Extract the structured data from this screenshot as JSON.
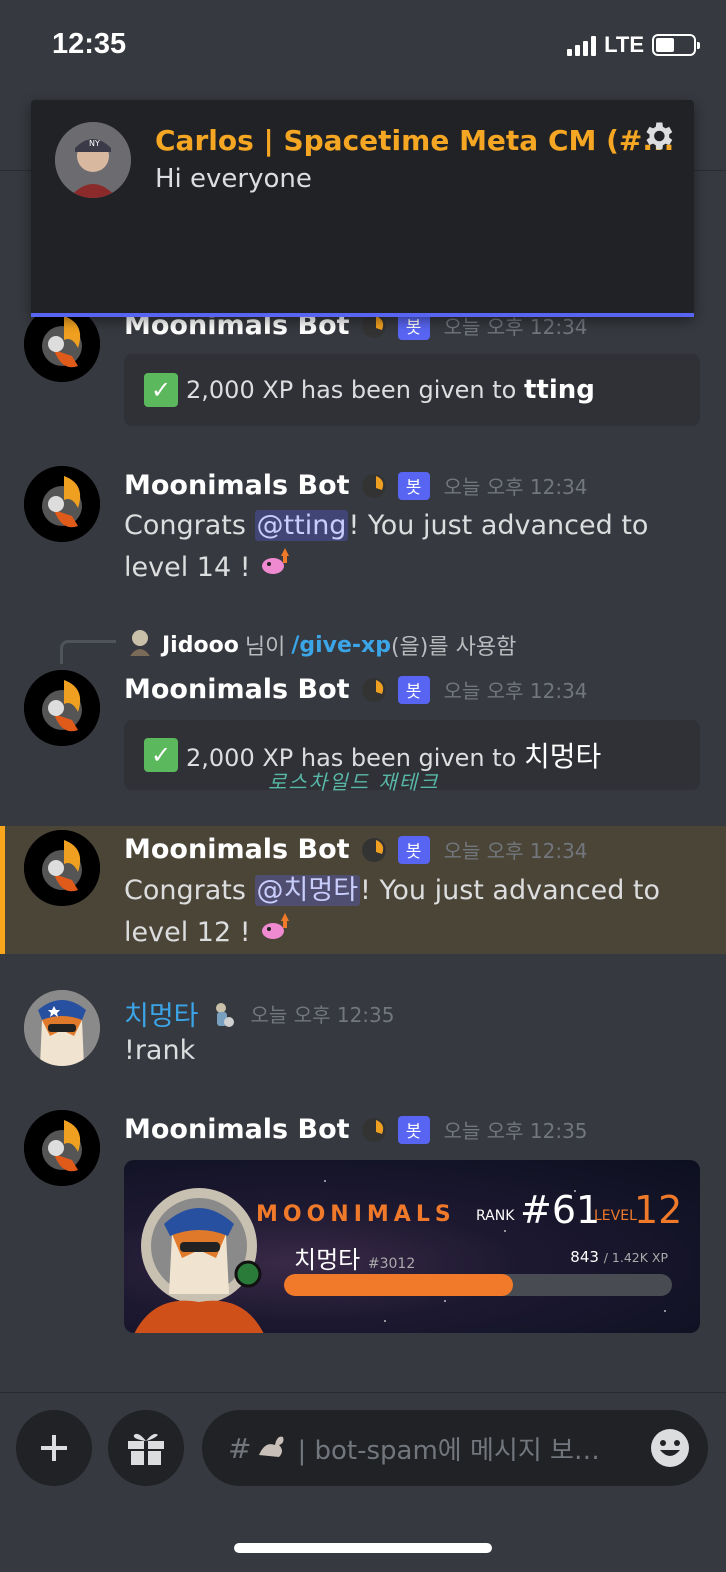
{
  "status_bar": {
    "time": "12:35",
    "network": "LTE"
  },
  "notification": {
    "author": "Carlos | Spacetime Meta CM (#...",
    "text": "Hi everyone"
  },
  "messages": [
    {
      "author": "Moonimals Bot",
      "badge": "봇",
      "timestamp": "오늘 오후 12:34",
      "embed_text": "2,000 XP has been given to ",
      "embed_bold": "tting"
    },
    {
      "author": "Moonimals Bot",
      "badge": "봇",
      "timestamp": "오늘 오후 12:34",
      "text_pre": "Congrats ",
      "mention": "@tting",
      "text_post": "! You just advanced to level 14 !"
    },
    {
      "author": "Moonimals Bot",
      "badge": "봇",
      "timestamp": "오늘 오후 12:34",
      "reply_user": "Jidooo",
      "reply_mid": "님이",
      "reply_cmd": "/give-xp",
      "reply_end": "(을)를 사용함",
      "embed_text": "2,000 XP has been given to ",
      "embed_bold": "치멍타"
    },
    {
      "author": "Moonimals Bot",
      "badge": "봇",
      "timestamp": "오늘 오후 12:34",
      "text_pre": "Congrats ",
      "mention": "@치멍타",
      "text_post": "! You just advanced to level 12 !"
    },
    {
      "author": "치멍타",
      "timestamp": "오늘 오후 12:35",
      "text": "!rank"
    },
    {
      "author": "Moonimals Bot",
      "badge": "봇",
      "timestamp": "오늘 오후 12:35"
    }
  ],
  "watermark": "로스차일드 재테크",
  "rank_card": {
    "logo": "MOONIMALS",
    "rank_label": "RANK",
    "rank": "#61",
    "level_label": "LEVEL",
    "level": "12",
    "username": "치멍타",
    "discriminator": "#3012",
    "xp_current": "843",
    "xp_total": "/ 1.42K XP",
    "progress": 0.59
  },
  "composer": {
    "hash": "#",
    "placeholder": "| bot-spam에 메시지 보…"
  },
  "colors": {
    "accent": "#5865f2",
    "orange": "#f07a2a",
    "mention_bg": "#5865f2",
    "highlight": "#faa61a"
  },
  "icons": [
    "gear-icon",
    "plus-icon",
    "gift-icon",
    "emoji-icon",
    "check-icon"
  ]
}
